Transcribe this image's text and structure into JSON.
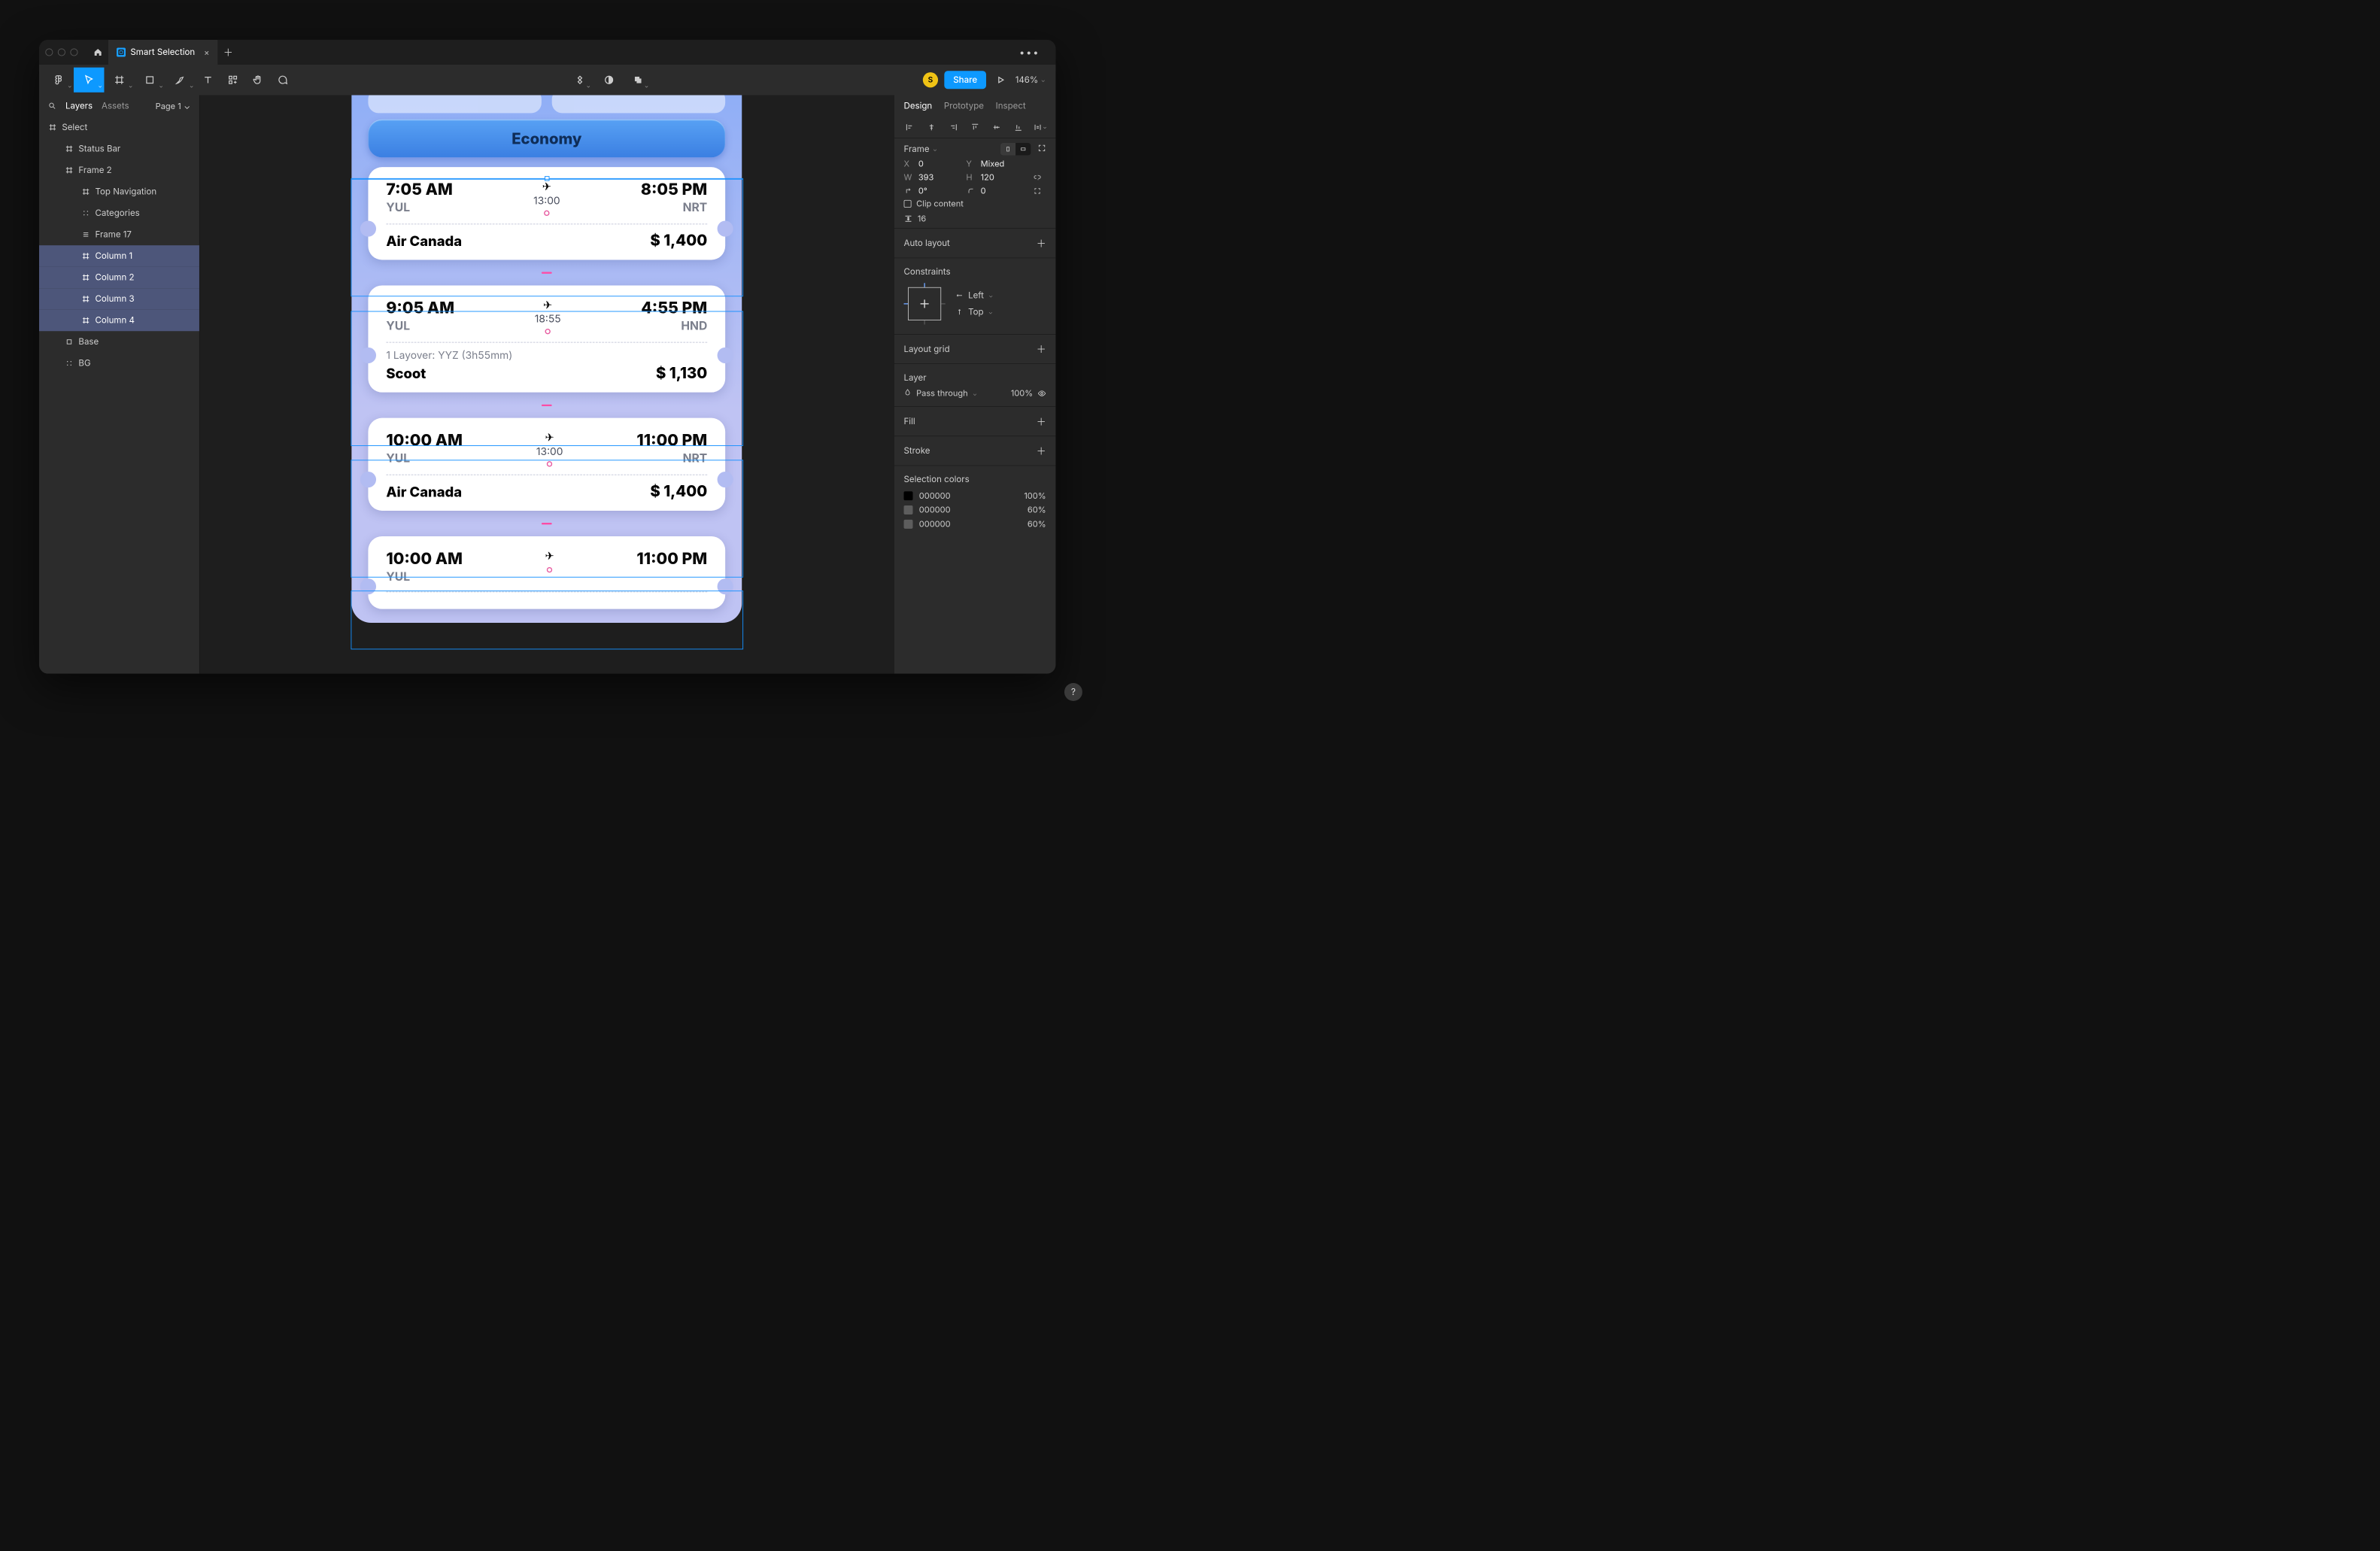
{
  "tab": {
    "title": "Smart Selection"
  },
  "toolbar": {
    "share": "Share",
    "zoom": "146%",
    "avatar_initial": "S"
  },
  "left_panel": {
    "tabs": {
      "layers": "Layers",
      "assets": "Assets"
    },
    "page_selector": "Page 1",
    "layers": [
      {
        "name": "Select",
        "depth": 0,
        "icon": "frame",
        "selected": false
      },
      {
        "name": "Status Bar",
        "depth": 1,
        "icon": "frame",
        "selected": false
      },
      {
        "name": "Frame 2",
        "depth": 1,
        "icon": "frame",
        "selected": false
      },
      {
        "name": "Top Navigation",
        "depth": 2,
        "icon": "frame",
        "selected": false
      },
      {
        "name": "Categories",
        "depth": 2,
        "icon": "group",
        "selected": false
      },
      {
        "name": "Frame 17",
        "depth": 2,
        "icon": "stack",
        "selected": false
      },
      {
        "name": "Column 1",
        "depth": 2,
        "icon": "frame",
        "selected": true
      },
      {
        "name": "Column 2",
        "depth": 2,
        "icon": "frame",
        "selected": true
      },
      {
        "name": "Column 3",
        "depth": 2,
        "icon": "frame",
        "selected": true
      },
      {
        "name": "Column 4",
        "depth": 2,
        "icon": "frame",
        "selected": true
      },
      {
        "name": "Base",
        "depth": 1,
        "icon": "rect",
        "selected": false
      },
      {
        "name": "BG",
        "depth": 1,
        "icon": "group",
        "selected": false
      }
    ]
  },
  "canvas": {
    "pill_label": "Economy",
    "cards": [
      {
        "dep_time": "7:05 AM",
        "dep_code": "YUL",
        "duration": "13:00",
        "arr_time": "8:05 PM",
        "arr_code": "NRT",
        "layover": "",
        "airline": "Air Canada",
        "price": "$ 1,400"
      },
      {
        "dep_time": "9:05 AM",
        "dep_code": "YUL",
        "duration": "18:55",
        "arr_time": "4:55 PM",
        "arr_code": "HND",
        "layover": "1 Layover: YYZ (3h55mm)",
        "airline": "Scoot",
        "price": "$ 1,130"
      },
      {
        "dep_time": "10:00 AM",
        "dep_code": "YUL",
        "duration": "13:00",
        "arr_time": "11:00 PM",
        "arr_code": "NRT",
        "layover": "",
        "airline": "Air Canada",
        "price": "$ 1,400"
      },
      {
        "dep_time": "10:00 AM",
        "dep_code": "YUL",
        "duration": "",
        "arr_time": "11:00 PM",
        "arr_code": "",
        "layover": "",
        "airline": "",
        "price": ""
      }
    ]
  },
  "right_panel": {
    "tabs": {
      "design": "Design",
      "prototype": "Prototype",
      "inspect": "Inspect"
    },
    "frame": {
      "label": "Frame",
      "x_label": "X",
      "x": "0",
      "y_label": "Y",
      "y": "Mixed",
      "w_label": "W",
      "w": "393",
      "h_label": "H",
      "h": "120",
      "rot": "0°",
      "radius": "0",
      "clip_label": "Clip content",
      "spacing": "16"
    },
    "auto_layout": "Auto layout",
    "constraints": {
      "label": "Constraints",
      "h": "Left",
      "v": "Top"
    },
    "layout_grid": "Layout grid",
    "layer": {
      "label": "Layer",
      "blend": "Pass through",
      "opacity": "100%"
    },
    "fill": "Fill",
    "stroke": "Stroke",
    "selection_colors": {
      "label": "Selection colors",
      "items": [
        {
          "hex": "000000",
          "pct": "100%",
          "swatch": "#000000"
        },
        {
          "hex": "000000",
          "pct": "60%",
          "swatch": "#5d5d5d"
        },
        {
          "hex": "000000",
          "pct": "60%",
          "swatch": "#5d5d5d"
        }
      ]
    }
  }
}
